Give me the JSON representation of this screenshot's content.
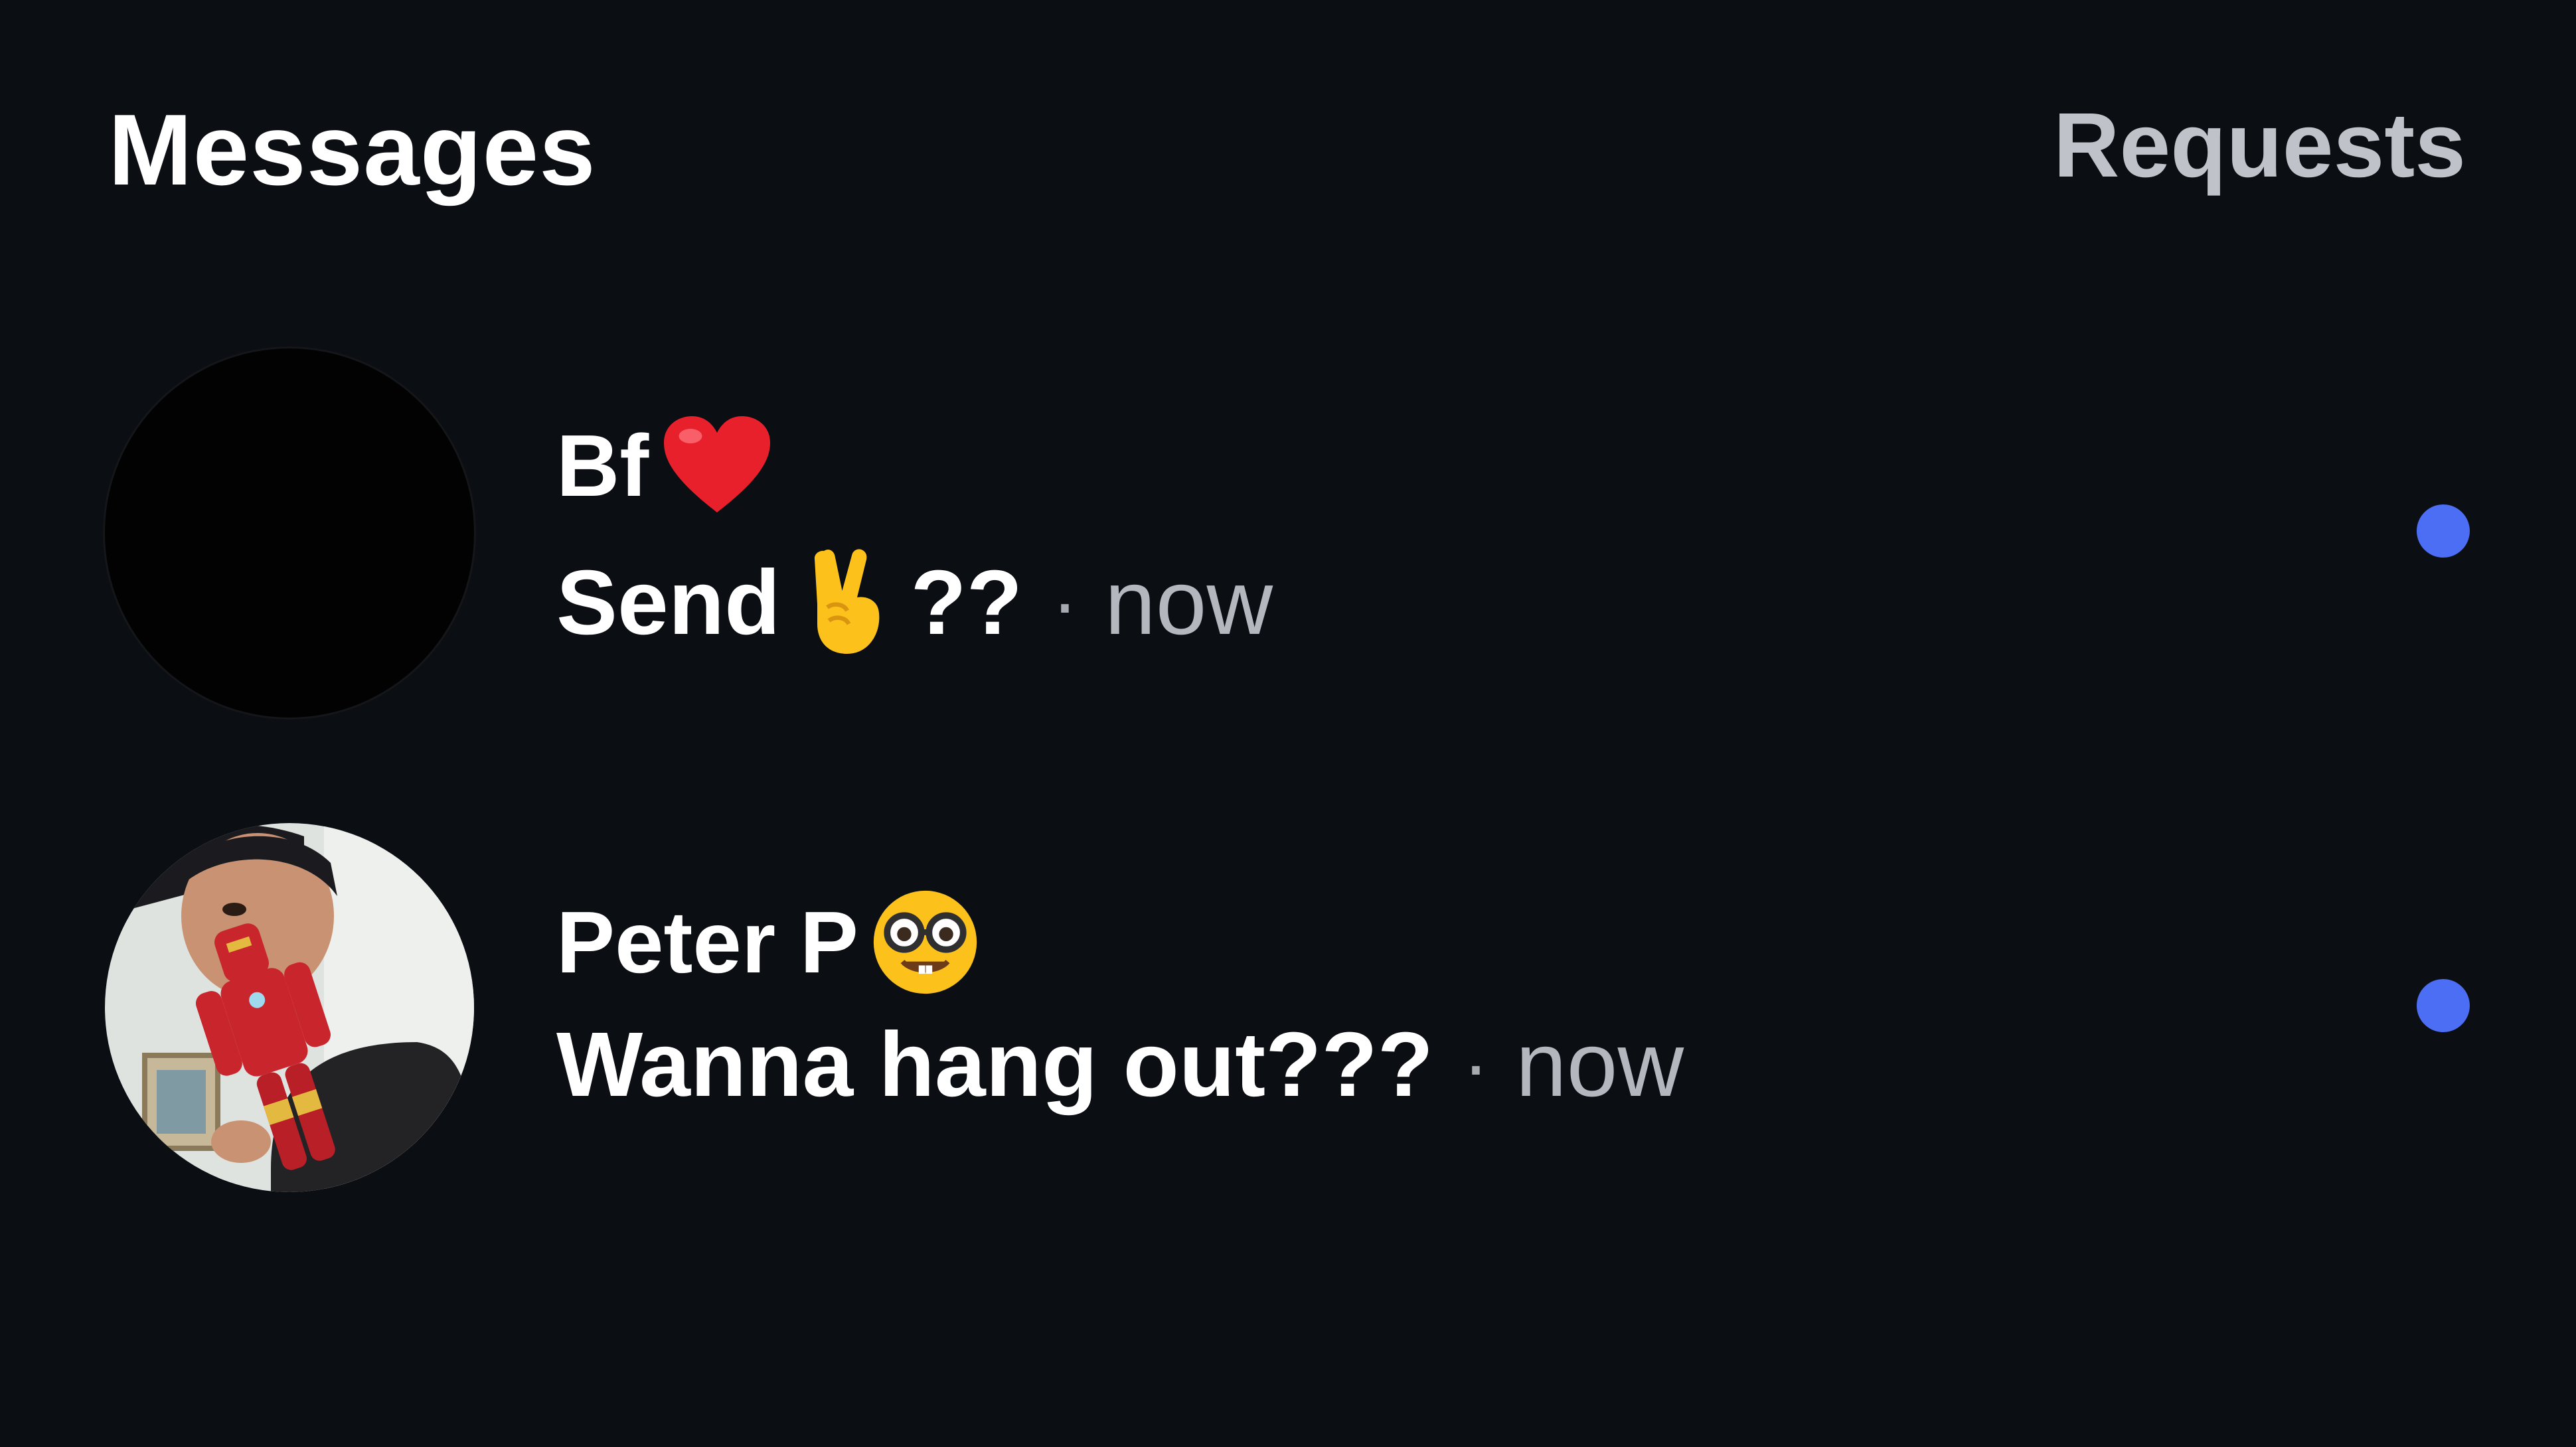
{
  "header": {
    "title": "Messages",
    "requests_label": "Requests"
  },
  "conversations": [
    {
      "name": "Bf",
      "name_emoji": "red-heart",
      "preview_text": "Send",
      "preview_emoji": "victory-hand",
      "preview_suffix": "??",
      "separator": "·",
      "time": "now",
      "unread": true,
      "avatar": "black-circle"
    },
    {
      "name": "Peter P",
      "name_emoji": "nerd-face",
      "preview_text": "Wanna hang out???",
      "separator": "·",
      "time": "now",
      "unread": true,
      "avatar": "photo"
    }
  ],
  "colors": {
    "background": "#0b0e13",
    "text_primary": "#ffffff",
    "text_secondary": "#b4b8be",
    "unread_dot": "#4c6ef5"
  }
}
